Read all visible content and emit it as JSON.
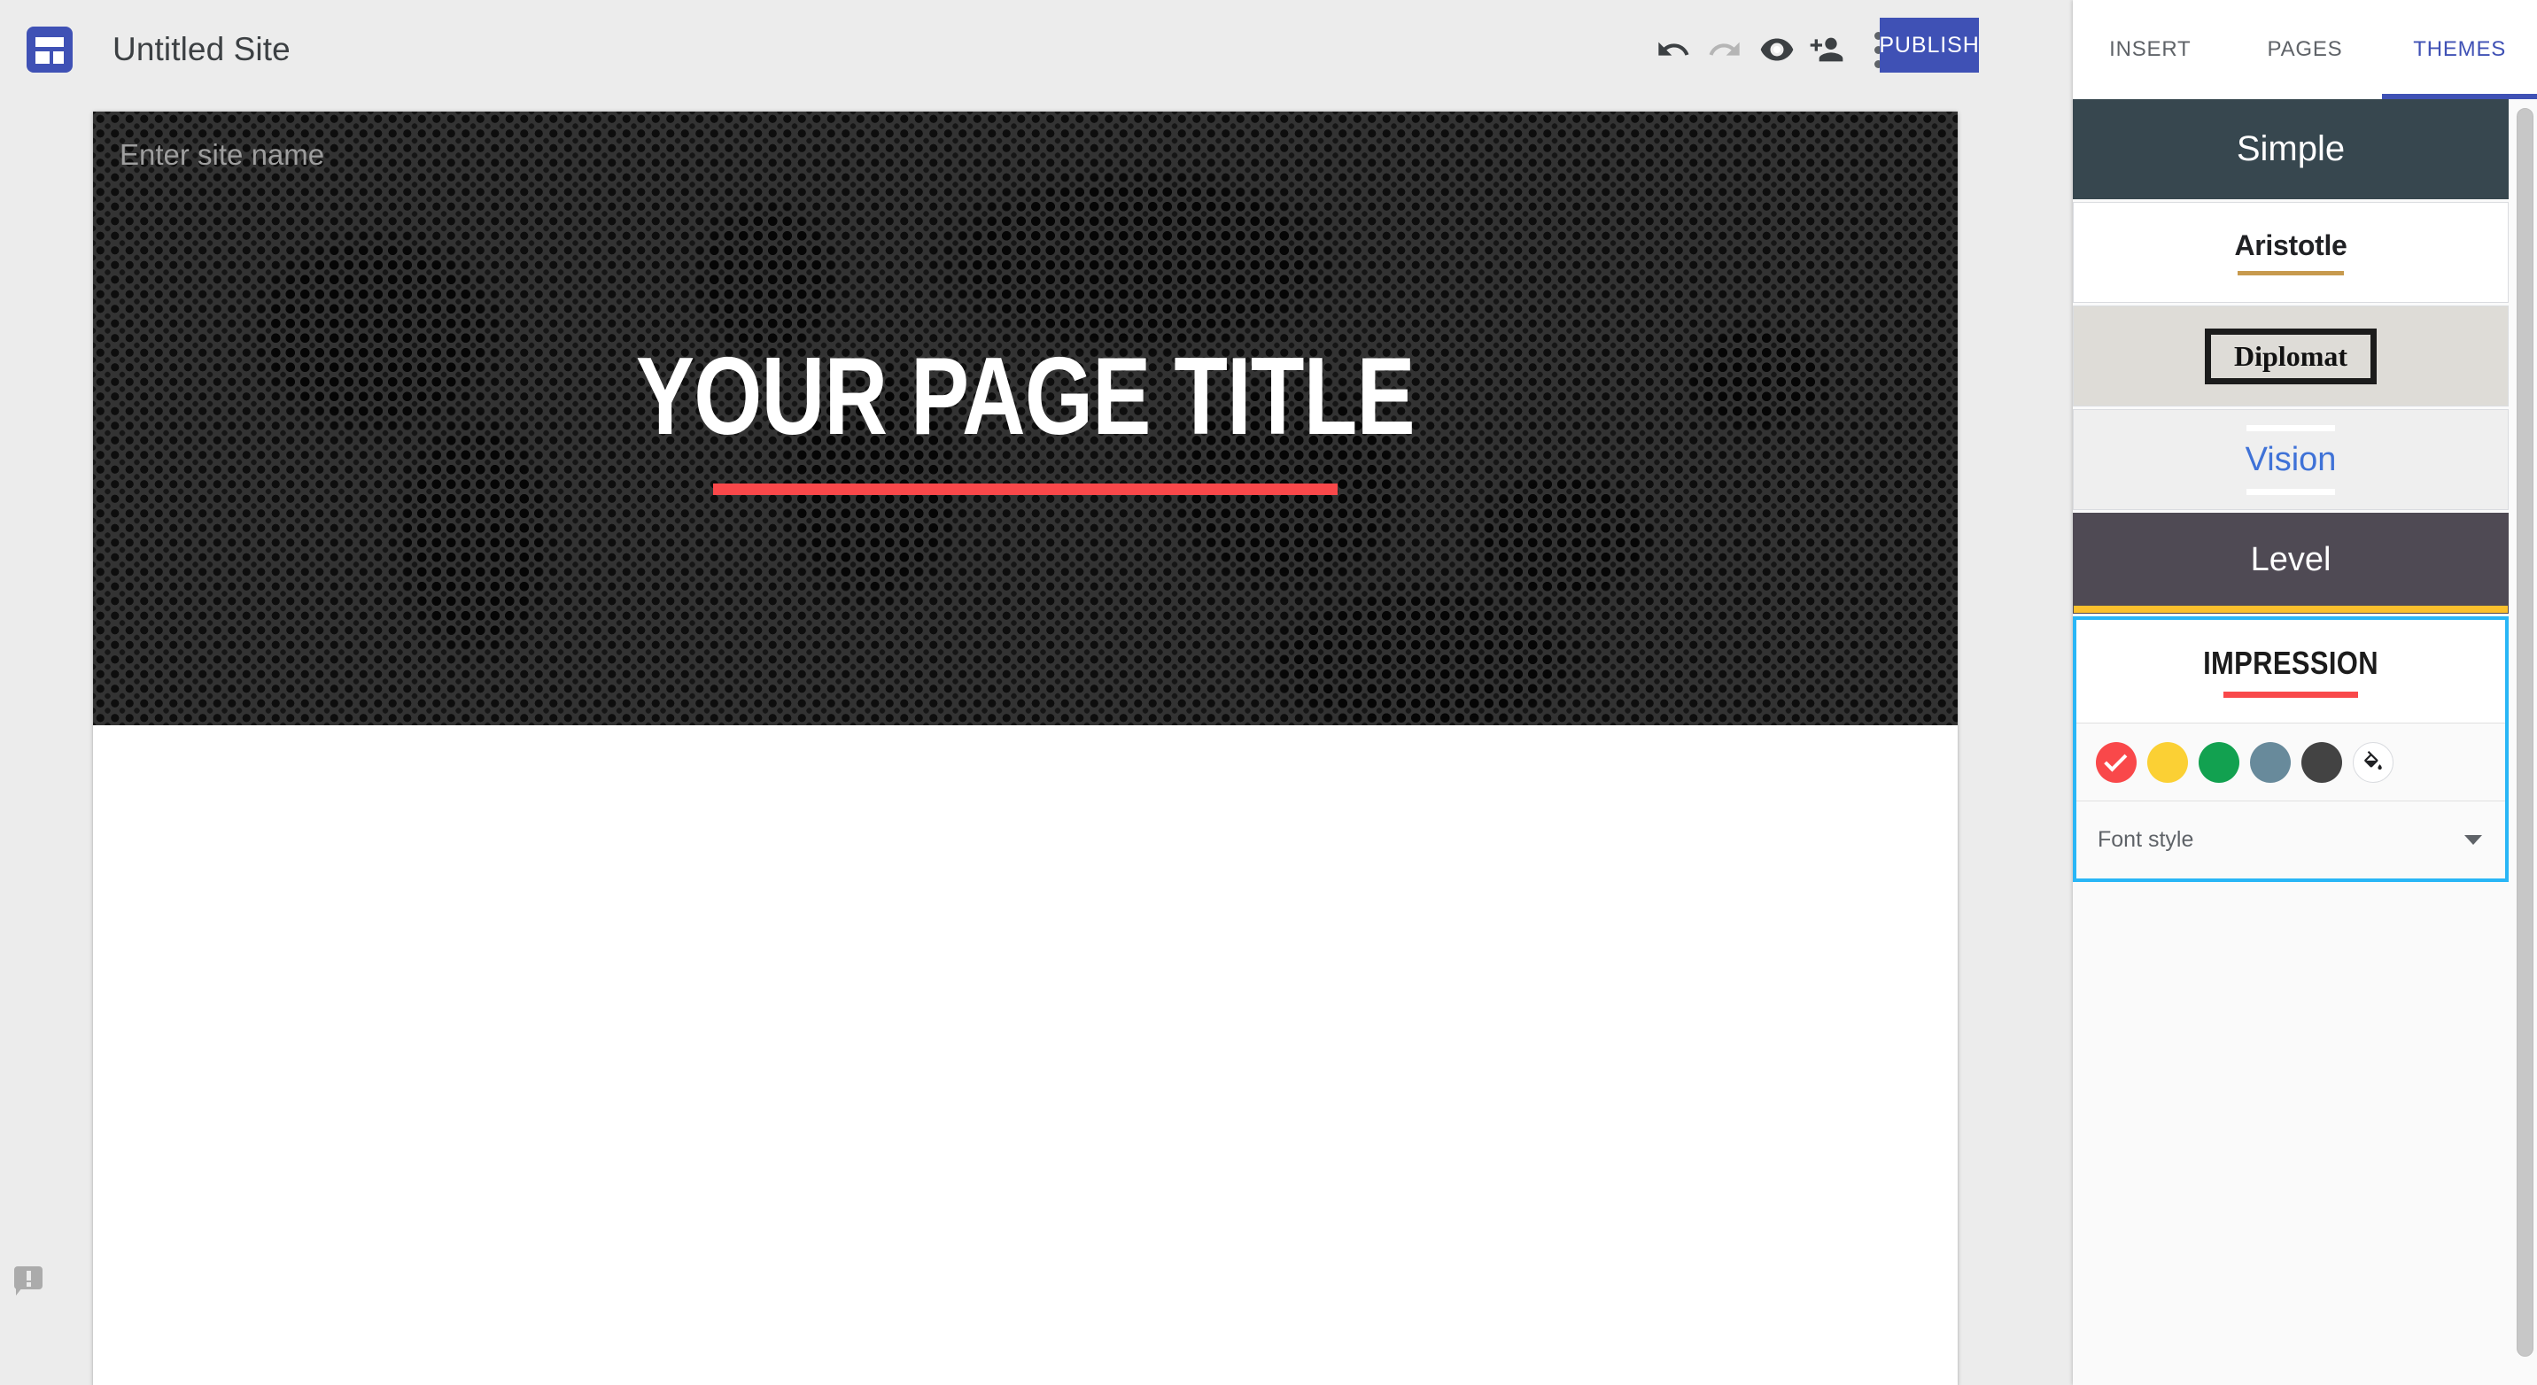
{
  "topbar": {
    "logo_icon": "google-sites-logo",
    "site_title": "Untitled Site",
    "undo_icon": "undo-arrow-icon",
    "redo_icon": "redo-arrow-icon",
    "preview_icon": "preview-eye-icon",
    "share_icon": "add-person-icon",
    "more_icon": "three-dot-more-icon",
    "publish_label": "PUBLISH",
    "publish_color": "#3F51B5"
  },
  "canvas": {
    "site_name_placeholder": "Enter site name",
    "site_name_value": "",
    "page_title": "YOUR PAGE TITLE",
    "banner_background_color": "#333333",
    "title_accent_color": "#F9484A",
    "feedback_icon": "report-feedback-icon"
  },
  "panel": {
    "tabs": [
      {
        "label": "INSERT",
        "active": false
      },
      {
        "label": "PAGES",
        "active": false
      },
      {
        "label": "THEMES",
        "active": true
      }
    ],
    "active_tab_color": "#3F51B5",
    "themes": [
      {
        "name": "Simple",
        "bg": "#37474F",
        "text_color": "#FFFFFF",
        "selected": false
      },
      {
        "name": "Aristotle",
        "bg": "#FFFFFF",
        "text_color": "#202124",
        "accent": "#C79A4E",
        "selected": false
      },
      {
        "name": "Diplomat",
        "bg": "#DEDCD7",
        "text_color": "#111111",
        "selected": false
      },
      {
        "name": "Vision",
        "bg": "#EFEFEF",
        "text_color": "#3F72D7",
        "accent": "#FFFFFF",
        "selected": false
      },
      {
        "name": "Level",
        "bg": "#4F4A54",
        "text_color": "#FFFFFF",
        "accent": "#FBC02D",
        "selected": false
      },
      {
        "name": "IMPRESSION",
        "bg": "#FFFFFF",
        "text_color": "#1C1C1C",
        "accent": "#F9484A",
        "selected": true
      }
    ],
    "selected_theme_outline": "#29B6F6",
    "color_swatches": [
      {
        "color": "#F9484A",
        "selected": true
      },
      {
        "color": "#FBD034",
        "selected": false
      },
      {
        "color": "#12A150",
        "selected": false
      },
      {
        "color": "#688A9B",
        "selected": false
      },
      {
        "color": "#434343",
        "selected": false
      }
    ],
    "custom_color_icon": "paint-bucket-icon",
    "font_style_label": "Font style",
    "font_style_caret_icon": "chevron-down-icon"
  }
}
